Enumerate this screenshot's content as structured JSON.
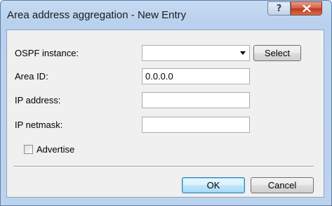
{
  "window": {
    "title": "Area address aggregation - New Entry"
  },
  "titlebar": {
    "help_glyph": "?",
    "close_glyph": "✕"
  },
  "form": {
    "ospf_instance": {
      "label": "OSPF instance:",
      "value": ""
    },
    "select_button": "Select",
    "area_id": {
      "label": "Area ID:",
      "value": "0.0.0.0"
    },
    "ip_address": {
      "label": "IP address:",
      "value": ""
    },
    "ip_netmask": {
      "label": "IP netmask:",
      "value": ""
    },
    "advertise": {
      "label": "Advertise",
      "checked": false
    }
  },
  "buttons": {
    "ok": "OK",
    "cancel": "Cancel"
  }
}
